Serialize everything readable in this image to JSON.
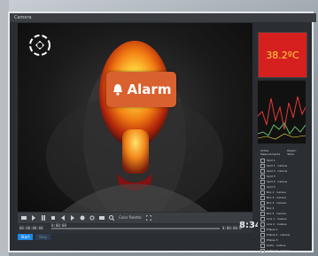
{
  "window": {
    "title": "Camera"
  },
  "alarm": {
    "label": "Alarm"
  },
  "temperature": {
    "value": "38.2ºC"
  },
  "clock": {
    "time": "8:34"
  },
  "toolbar": {
    "mode_label": "Color\nPalette"
  },
  "timeline": {
    "start": "00:00:00:00",
    "current": "0:00:00",
    "end": "0:00:00:0"
  },
  "buttons": {
    "start": "Start",
    "stop": "Stop"
  },
  "panel": {
    "header_left": "Active Measurements",
    "header_right": "Region Temp",
    "items": [
      "Spot 1",
      "Spot 1 · Celsius",
      "Spot 2 · Celsius",
      "Spot 3",
      "Spot 4 · Celsius",
      "Spot 5",
      "Box 1 · Celsius",
      "Box 2 · Celsius",
      "Box 3 · Celsius",
      "Box 4",
      "Box 5 · Celsius",
      "Line 1 · Celsius",
      "Line 2 · Celsius",
      "Ellipse 1",
      "Ellipse 2 · Celsius",
      "Ellipse 3",
      "Delta · Celsius",
      "Isotherm · Celsius"
    ]
  }
}
